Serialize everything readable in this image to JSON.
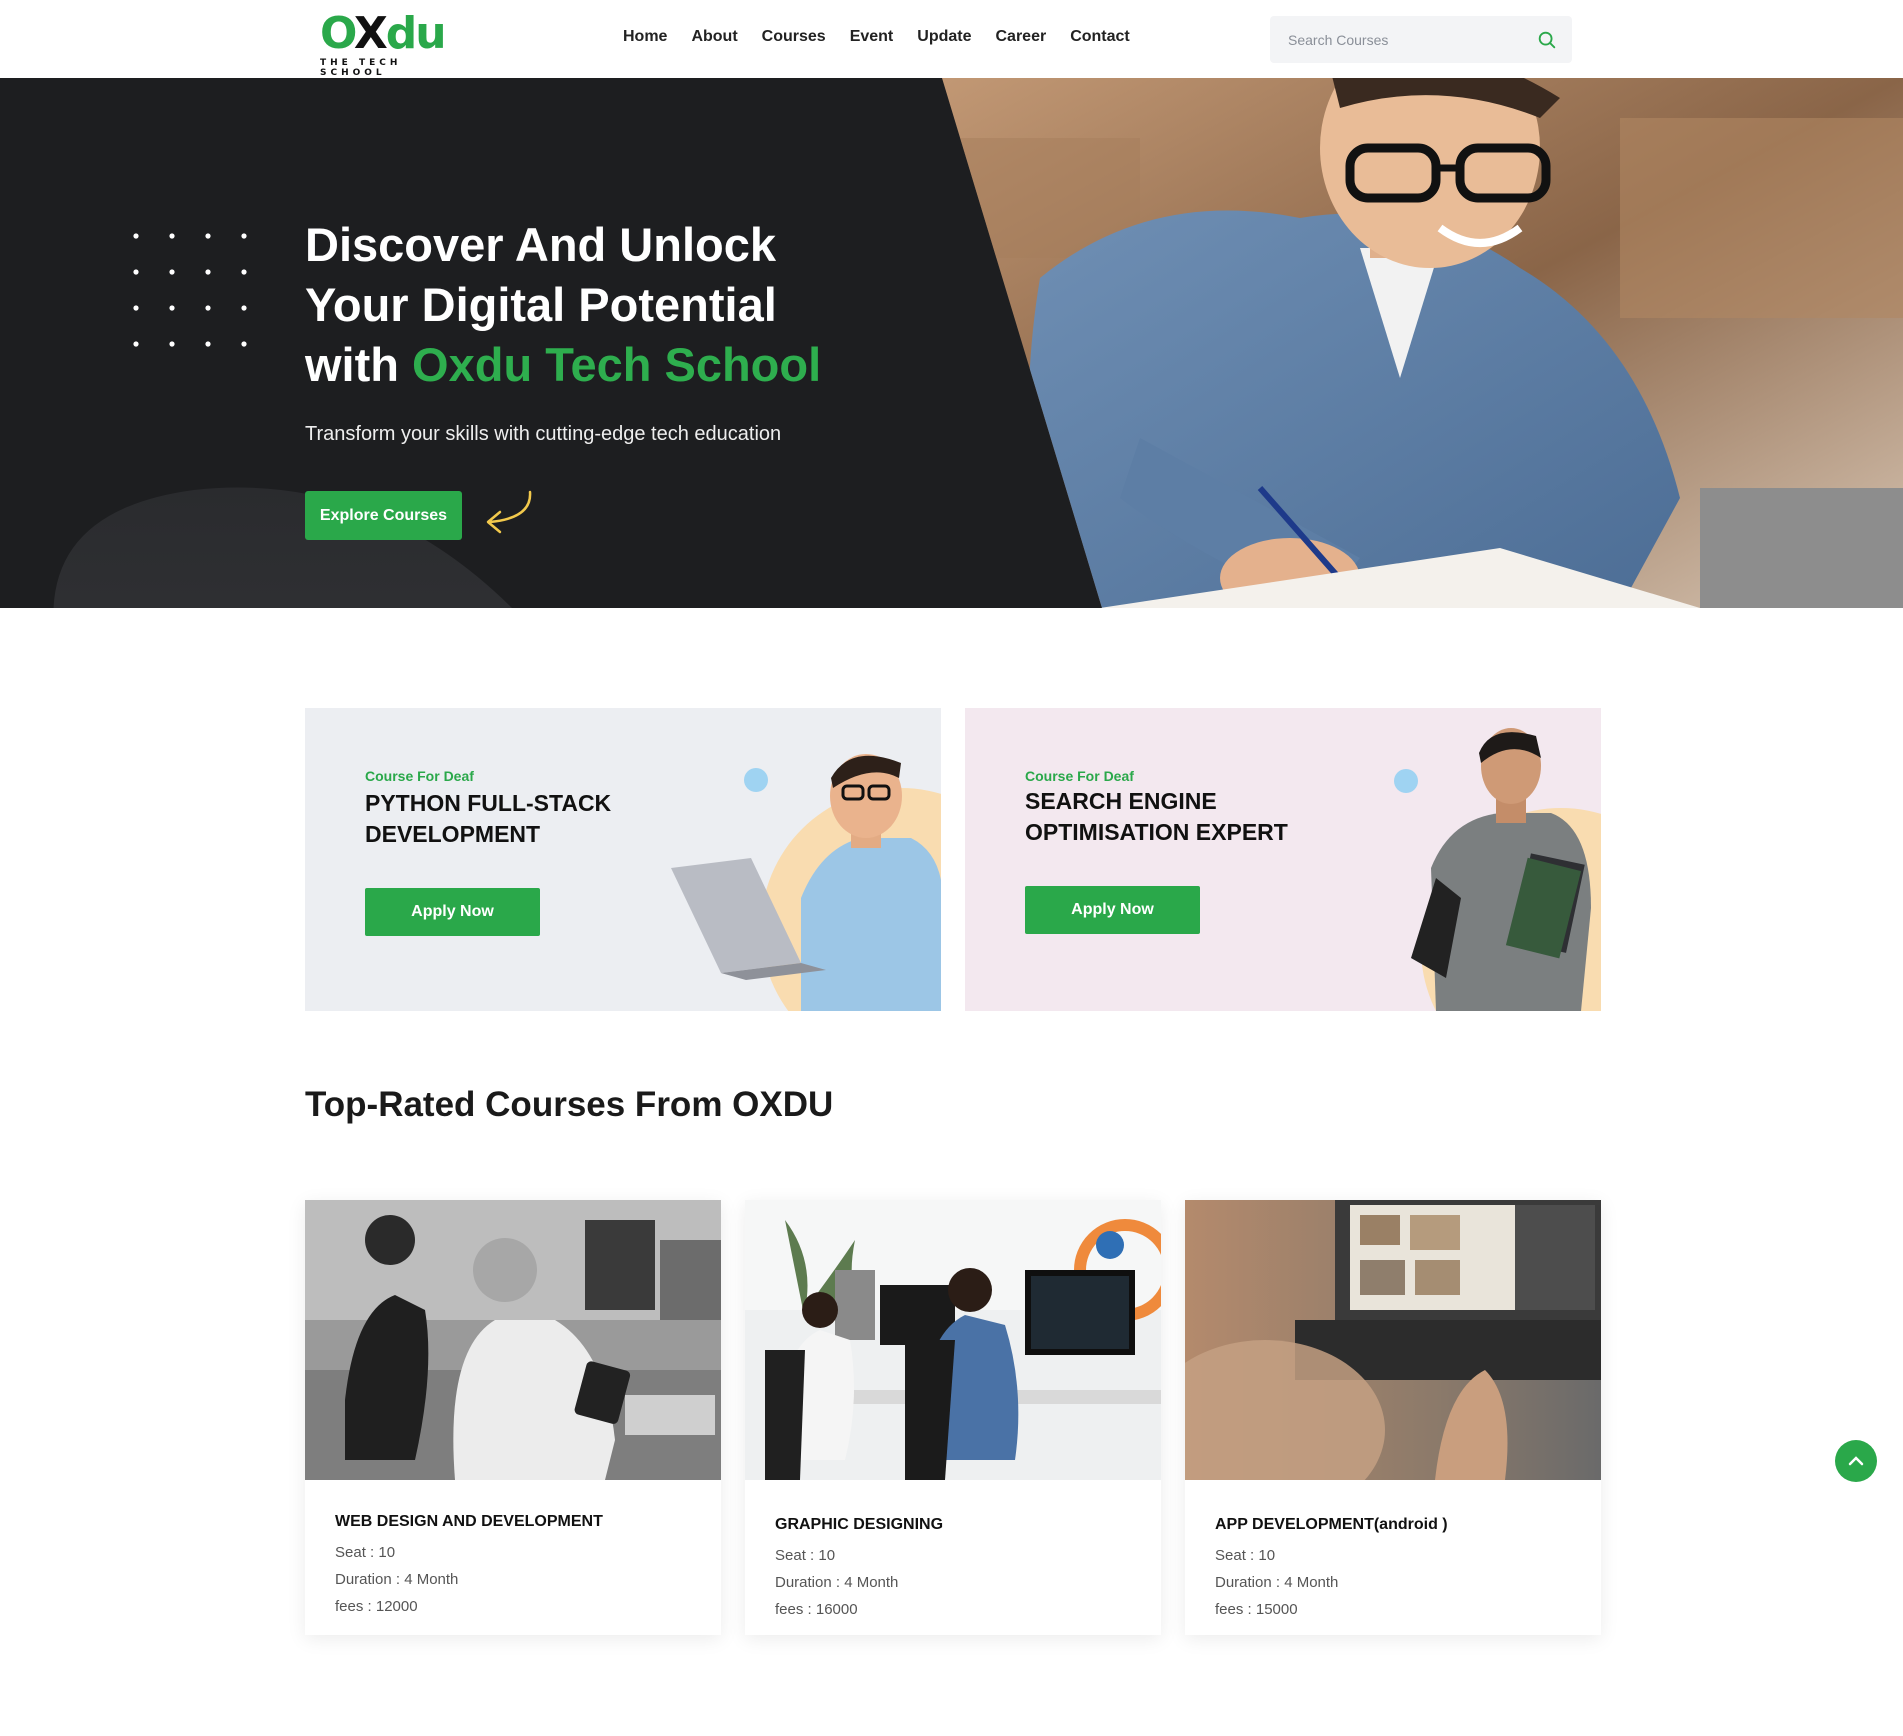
{
  "brand": {
    "logo_green": "O",
    "logo_dark": "X",
    "logo_rest": "du",
    "tagline": "THE TECH SCHOOL",
    "accent": "#2aa84a",
    "hero_bg": "#1d1e20"
  },
  "nav": {
    "items": [
      "Home",
      "About",
      "Courses",
      "Event",
      "Update",
      "Career",
      "Contact"
    ]
  },
  "search": {
    "placeholder": "Search Courses",
    "icon": "search-icon"
  },
  "hero": {
    "title_line1": "Discover And Unlock",
    "title_line2": "Your Digital Potential",
    "title_line3_prefix": "with ",
    "title_line3_highlight": "Oxdu Tech School",
    "subtitle": "Transform your skills with cutting-edge tech education",
    "cta": "Explore Courses"
  },
  "promos": [
    {
      "kicker": "Course For Deaf",
      "title_line1": "PYTHON FULL-STACK",
      "title_line2": "DEVELOPMENT",
      "cta": "Apply Now"
    },
    {
      "kicker": "Course For Deaf",
      "title_line1": "SEARCH ENGINE",
      "title_line2": "OPTIMISATION EXPERT",
      "cta": "Apply Now"
    }
  ],
  "courses_section": {
    "title": "Top-Rated Courses From OXDU"
  },
  "courses": [
    {
      "name": "WEB DESIGN AND DEVELOPMENT",
      "seat": "Seat : 10",
      "duration": "Duration : 4 Month",
      "fees": "fees : 12000"
    },
    {
      "name": "GRAPHIC DESIGNING",
      "seat": "Seat : 10",
      "duration": "Duration : 4 Month",
      "fees": "fees : 16000"
    },
    {
      "name": "APP DEVELOPMENT(android )",
      "seat": "Seat : 10",
      "duration": "Duration : 4 Month",
      "fees": "fees : 15000"
    }
  ]
}
